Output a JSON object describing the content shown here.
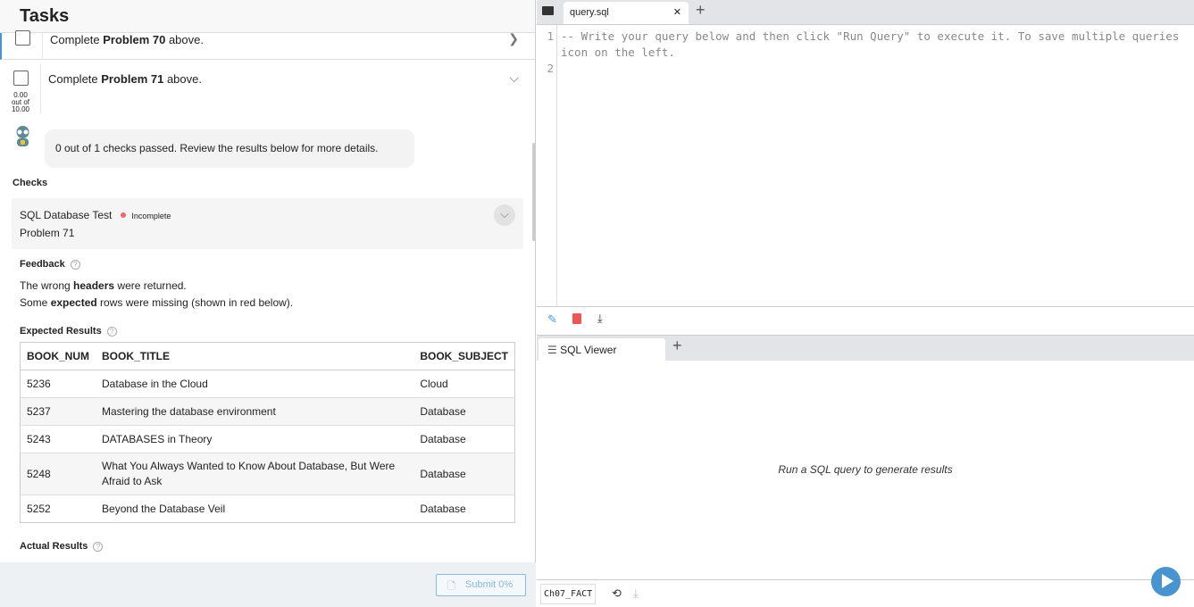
{
  "header": {
    "title": "Tasks"
  },
  "tasks": [
    {
      "prefix": "Complete ",
      "bold": "Problem 70",
      "suffix": " above."
    },
    {
      "prefix": "Complete ",
      "bold": "Problem 71",
      "suffix": " above.",
      "score": "0.00",
      "out_of": "out of",
      "max": "10.00"
    }
  ],
  "bot_message": "0 out of 1 checks passed. Review the results below for more details.",
  "checks_label": "Checks",
  "check": {
    "name": "SQL Database Test",
    "status": "Incomplete",
    "problem": "Problem 71"
  },
  "feedback": {
    "label": "Feedback",
    "l1a": "The wrong ",
    "l1b": "headers",
    "l1c": " were returned.",
    "l2a": "Some ",
    "l2b": "expected",
    "l2c": " rows were missing (shown in red below)."
  },
  "expected_label": "Expected Results",
  "actual_label": "Actual Results",
  "columns": [
    "BOOK_NUM",
    "BOOK_TITLE",
    "BOOK_SUBJECT"
  ],
  "rows": [
    [
      "5236",
      "Database in the Cloud",
      "Cloud"
    ],
    [
      "5237",
      "Mastering the database environment",
      "Database"
    ],
    [
      "5243",
      "DATABASES in Theory",
      "Database"
    ],
    [
      "5248",
      "What You Always Wanted to Know About Database, But Were Afraid to Ask",
      "Database"
    ],
    [
      "5252",
      "Beyond the Database Veil",
      "Database"
    ]
  ],
  "submit_label": "Submit 0%",
  "editor": {
    "tab": "query.sql",
    "line_numbers": [
      "1",
      "2"
    ],
    "code": "-- Write your query below and then click \"Run Query\" to execute it. To save multiple queries\nicon on the left.\n"
  },
  "viewer": {
    "tab": "SQL Viewer",
    "empty": "Run a SQL query to generate results"
  },
  "database": "Ch07_FACT",
  "colors": {
    "accent": "#4794d0",
    "incomplete": "#e66666"
  }
}
